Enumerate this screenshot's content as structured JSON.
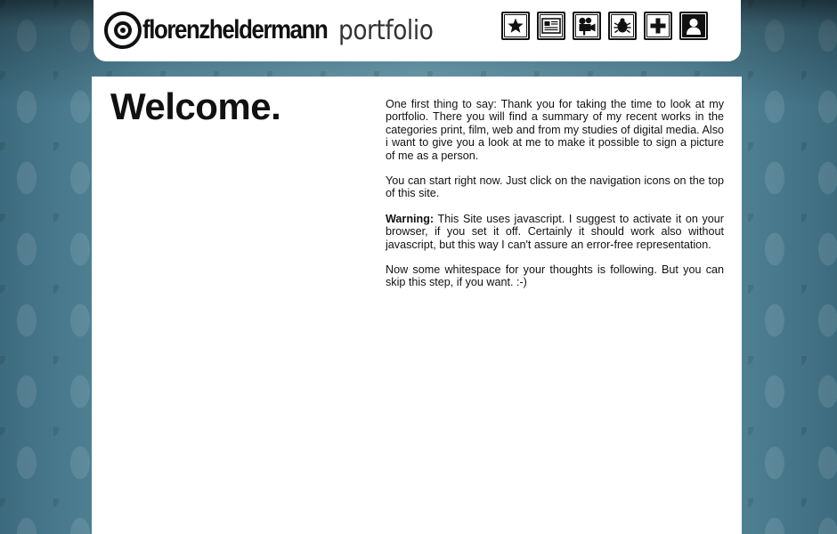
{
  "header": {
    "logo_name": "florenzheldermann",
    "logo_suffix": "portfolio",
    "nav": [
      {
        "name": "nav-star-button",
        "icon": "star-icon"
      },
      {
        "name": "nav-print-button",
        "icon": "newspaper-icon"
      },
      {
        "name": "nav-film-button",
        "icon": "film-camera-icon"
      },
      {
        "name": "nav-web-button",
        "icon": "bug-icon"
      },
      {
        "name": "nav-studies-button",
        "icon": "plus-icon"
      },
      {
        "name": "nav-me-button",
        "icon": "person-icon"
      }
    ]
  },
  "main": {
    "heading": "Welcome.",
    "paragraphs": {
      "p1": "One first thing to say: Thank you for taking the time to look at my portfolio. There you will find a summary of my recent works in the categories print, film, web and from my studies of digital media. Also i want to give you a look at me to make it possible to sign a picture of me as a person.",
      "p2": "You can start right now. Just click on the navigation icons on the top of this site.",
      "p3_label": "Warning:",
      "p3_text": " This Site uses javascript. I suggest to activate it on your browser, if you set it off. Certainly it should work also without javascript, but this way I can't assure an error-free representation.",
      "p4": "Now some whitespace for your thoughts is following. But you can skip this step, if you want. :-)"
    }
  },
  "colors": {
    "background": "#4e7f92",
    "panel": "#ffffff",
    "text": "#111111"
  }
}
